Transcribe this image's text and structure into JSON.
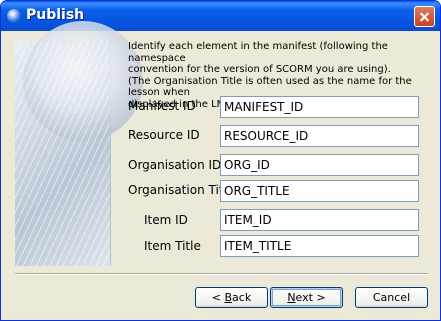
{
  "window": {
    "title": "Publish"
  },
  "instructions": {
    "line1": "Identify each element in the manifest (following the namespace",
    "line2": "convention for the version of SCORM you are using).",
    "line3": "(The Organisation Title is often used as the name for the lesson when",
    "line4": "displayed in the LMS.)"
  },
  "fields": {
    "manifest_id": {
      "label": "Manifest ID",
      "value": "MANIFEST_ID"
    },
    "resource_id": {
      "label": "Resource ID",
      "value": "RESOURCE_ID"
    },
    "organisation_id": {
      "label": "Organisation ID",
      "value": "ORG_ID"
    },
    "organisation_title": {
      "label": "Organisation Title",
      "value": "ORG_TITLE"
    },
    "item_id": {
      "label": "Item ID",
      "value": "ITEM_ID"
    },
    "item_title": {
      "label": "Item Title",
      "value": "ITEM_TITLE"
    }
  },
  "buttons": {
    "back": {
      "prefix": "< ",
      "mnemonic": "B",
      "rest": "ack"
    },
    "next": {
      "mnemonic": "N",
      "rest": "ext >"
    },
    "cancel": {
      "label": "Cancel"
    }
  },
  "icons": {
    "app": "globe-icon",
    "close": "close-icon"
  }
}
